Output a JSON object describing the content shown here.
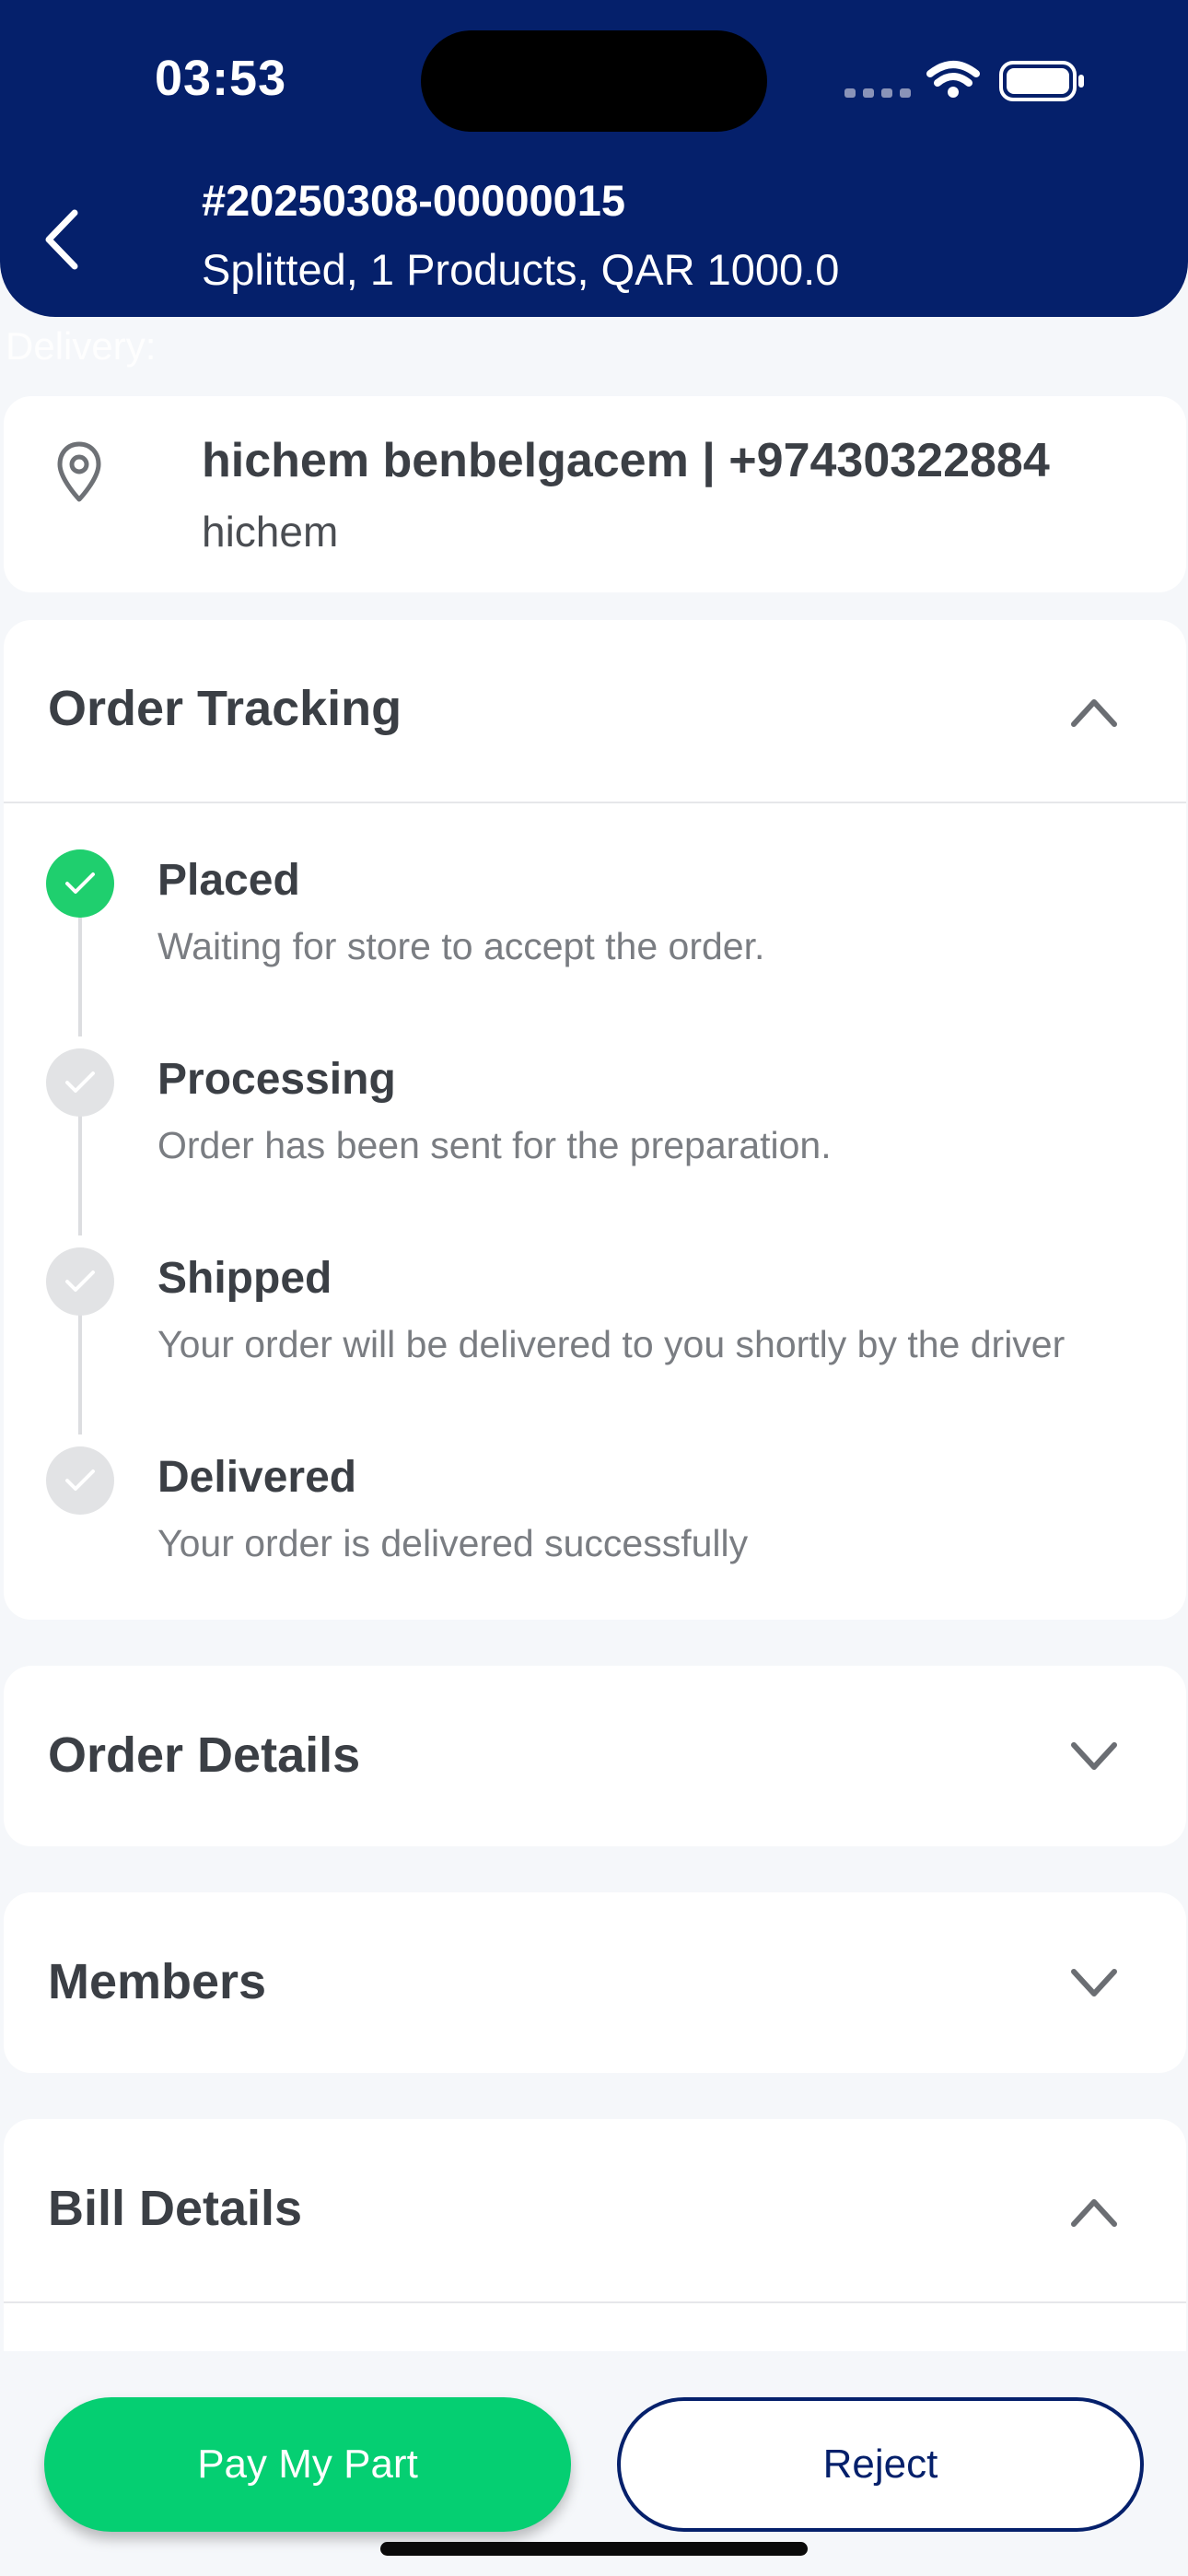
{
  "status_bar": {
    "time": "03:53",
    "signal_icon": "cellular-signal-dots",
    "wifi_icon": "wifi-icon",
    "battery_icon": "battery-icon"
  },
  "header": {
    "order_number": "#20250308-00000015",
    "summary": "Splitted, 1 Products, QAR 1000.0",
    "background_color": "#05206b"
  },
  "ghost_label": "Delivery:",
  "address": {
    "name_phone": "hichem benbelgacem | +97430322884",
    "detail": "hichem"
  },
  "order_tracking": {
    "title": "Order Tracking",
    "expanded": true,
    "steps": [
      {
        "title": "Placed",
        "description": "Waiting for store to accept the order.",
        "status": "done"
      },
      {
        "title": "Processing",
        "description": "Order has been sent for the preparation.",
        "status": "pending"
      },
      {
        "title": "Shipped",
        "description": "Your order will be delivered to you shortly by the driver",
        "status": "pending"
      },
      {
        "title": "Delivered",
        "description": "Your order is delivered successfully",
        "status": "pending"
      }
    ]
  },
  "order_details": {
    "title": "Order Details",
    "expanded": false
  },
  "members": {
    "title": "Members",
    "expanded": false
  },
  "bill_details": {
    "title": "Bill Details",
    "expanded": true
  },
  "actions": {
    "pay_label": "Pay My Part",
    "reject_label": "Reject",
    "pay_color": "#05cf72",
    "reject_color": "#05206b"
  }
}
